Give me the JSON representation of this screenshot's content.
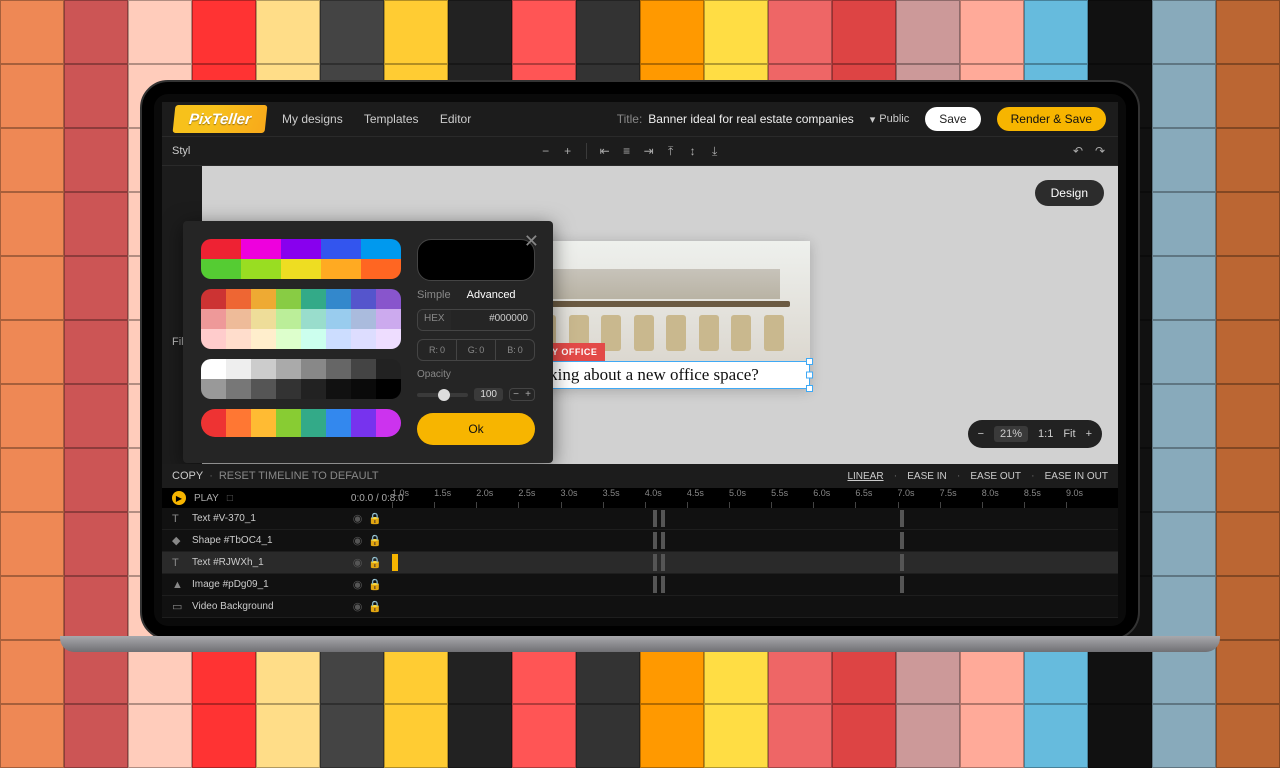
{
  "brand": "PixTeller",
  "nav": {
    "my_designs": "My designs",
    "templates": "Templates",
    "editor": "Editor"
  },
  "title": {
    "label": "Title:",
    "value": "Banner ideal for real estate companies"
  },
  "visibility": "Public",
  "buttons": {
    "save": "Save",
    "render": "Render & Save",
    "design": "Design",
    "ok": "Ok"
  },
  "sidepanel": {
    "style": "Styl",
    "filter": "Filte"
  },
  "canvas": {
    "badge": "FIND MY OFFICE",
    "headline": "Thinking about a new office space?"
  },
  "zoom": {
    "percent": "21%",
    "one_to_one": "1:1",
    "fit": "Fit"
  },
  "color_popup": {
    "tab_simple": "Simple",
    "tab_advanced": "Advanced",
    "hex_label": "HEX",
    "hex_value": "#000000",
    "r_label": "R:",
    "r_val": "0",
    "g_label": "G:",
    "g_val": "0",
    "b_label": "B:",
    "b_val": "0",
    "opacity_label": "Opacity",
    "opacity_value": "100"
  },
  "timeline": {
    "copy": "COPY",
    "reset": "RESET TIMELINE TO DEFAULT",
    "easings": {
      "linear": "LINEAR",
      "ease_in": "EASE IN",
      "ease_out": "EASE OUT",
      "ease_in_out": "EASE IN OUT"
    },
    "play": "PLAY",
    "time": "0:0.0 / 0:8.0",
    "marks": [
      "1.0s",
      "1.5s",
      "2.0s",
      "2.5s",
      "3.0s",
      "3.5s",
      "4.0s",
      "4.5s",
      "5.0s",
      "5.5s",
      "6.0s",
      "6.5s",
      "7.0s",
      "7.5s",
      "8.0s",
      "8.5s",
      "9.0s"
    ],
    "tracks": [
      {
        "label": "Text #V-370_1"
      },
      {
        "label": "Shape #TbOC4_1"
      },
      {
        "label": "Text #RJWXh_1"
      },
      {
        "label": "Image #pDg09_1"
      },
      {
        "label": "Video Background"
      }
    ]
  }
}
